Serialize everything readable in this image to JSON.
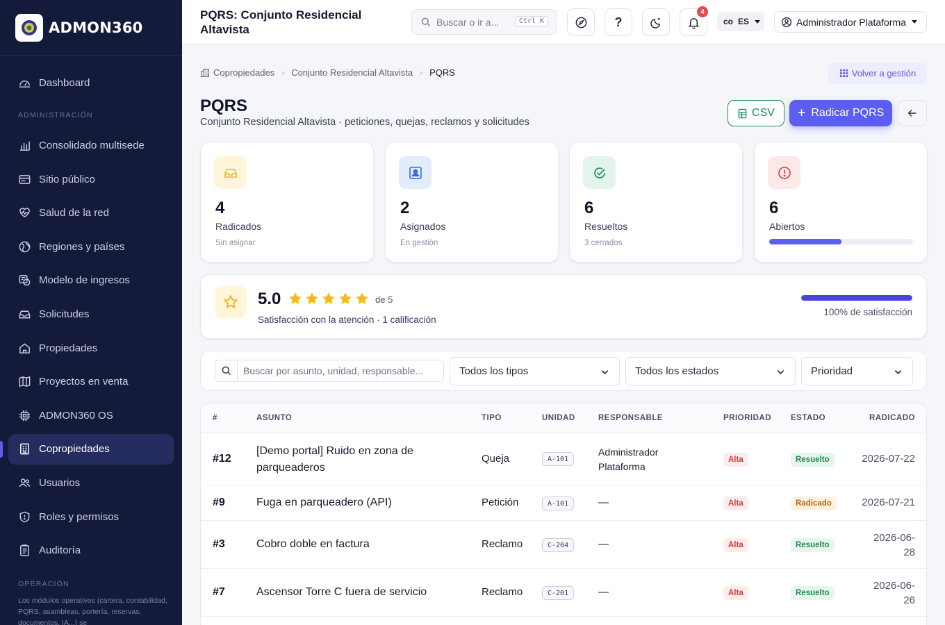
{
  "brand": {
    "name": "ADMON360"
  },
  "topbar": {
    "title": "PQRS: Conjunto Residencial Altavista",
    "search_placeholder": "Buscar o ir a...",
    "shortcut": "Ctrl K",
    "notifications_count": "4",
    "lang_flag": "co",
    "lang_code": "ES",
    "user_name": "Administrador Plataforma"
  },
  "sidebar": {
    "dashboard": "Dashboard",
    "section_admin": "ADMINISTRACIÓN",
    "items": [
      {
        "label": "Consolidado multisede",
        "icon": "bar-chart-icon"
      },
      {
        "label": "Sitio público",
        "icon": "window-icon"
      },
      {
        "label": "Salud de la red",
        "icon": "heart-pulse-icon"
      },
      {
        "label": "Regiones y países",
        "icon": "globe-icon"
      },
      {
        "label": "Modelo de ingresos",
        "icon": "coins-icon"
      },
      {
        "label": "Solicitudes",
        "icon": "inbox-icon"
      },
      {
        "label": "Propiedades",
        "icon": "house-icon"
      },
      {
        "label": "Proyectos en venta",
        "icon": "map-icon"
      },
      {
        "label": "ADMON360 OS",
        "icon": "chip-icon"
      },
      {
        "label": "Copropiedades",
        "icon": "building-icon",
        "active": true
      },
      {
        "label": "Usuarios",
        "icon": "users-icon"
      },
      {
        "label": "Roles y permisos",
        "icon": "shield-icon"
      },
      {
        "label": "Auditoría",
        "icon": "clipboard-icon"
      }
    ],
    "section_ops": "OPERACIÓN",
    "ops_note": "Los módulos operativos (cartera, contabilidad, PQRS, asambleas, portería, reservas, documentos, IA...) se"
  },
  "breadcrumb": {
    "items": [
      "Copropiedades",
      "Conjunto Residencial Altavista"
    ],
    "current": "PQRS",
    "back_label": "Volver a gestión"
  },
  "page": {
    "title": "PQRS",
    "subtitle": "Conjunto Residencial Altavista · peticiones, quejas, reclamos y solicitudes",
    "csv_label": "CSV",
    "primary_label": "Radicar PQRS"
  },
  "stats": [
    {
      "value": "4",
      "label": "Radicados",
      "sub": "Sin asignar",
      "icon": "inbox-icon",
      "color": "#f2b21a",
      "bg": "#fff5d9"
    },
    {
      "value": "2",
      "label": "Asignados",
      "sub": "En gestión",
      "icon": "user-card-icon",
      "color": "#2f6fe0",
      "bg": "#e3ecfb"
    },
    {
      "value": "6",
      "label": "Resueltos",
      "sub": "3 cerrados",
      "icon": "check-badge-icon",
      "color": "#1e8a4f",
      "bg": "#e3f5ea"
    },
    {
      "value": "6",
      "label": "Abiertos",
      "progress": 0.5,
      "icon": "alert-circle-icon",
      "color": "#d23a3a",
      "bg": "#fde8e8"
    }
  ],
  "rating": {
    "value": "5.0",
    "stars": 5,
    "of_label": "de 5",
    "caption": "Satisfacción con la atención · 1 calificación",
    "satisfaction_pct": 1.0,
    "satisfaction_label": "100% de satisfacción"
  },
  "filters": {
    "search_placeholder": "Buscar por asunto, unidad, responsable...",
    "type_value": "Todos los tipos",
    "status_value": "Todos los estados",
    "priority_value": "Prioridad"
  },
  "table": {
    "headers": [
      "#",
      "ASUNTO",
      "TIPO",
      "UNIDAD",
      "RESPONSABLE",
      "PRIORIDAD",
      "ESTADO",
      "RADICADO"
    ],
    "rows": [
      {
        "num": "#12",
        "subject": "[Demo portal] Ruido en zona de parqueaderos",
        "type": "Queja",
        "unit": "A-101",
        "owner": "Administrador Plataforma",
        "priority": "Alta",
        "status": "Resuelto",
        "date": "2026-07-22"
      },
      {
        "num": "#9",
        "subject": "Fuga en parqueadero (API)",
        "type": "Petición",
        "unit": "A-101",
        "owner": "—",
        "priority": "Alta",
        "status": "Radicado",
        "date": "2026-07-21"
      },
      {
        "num": "#3",
        "subject": "Cobro doble en factura",
        "type": "Reclamo",
        "unit": "C-204",
        "owner": "—",
        "priority": "Alta",
        "status": "Resuelto",
        "date": "2026-06-28"
      },
      {
        "num": "#7",
        "subject": "Ascensor Torre C fuera de servicio",
        "type": "Reclamo",
        "unit": "C-201",
        "owner": "—",
        "priority": "Alta",
        "status": "Resuelto",
        "date": "2026-06-26"
      }
    ]
  }
}
